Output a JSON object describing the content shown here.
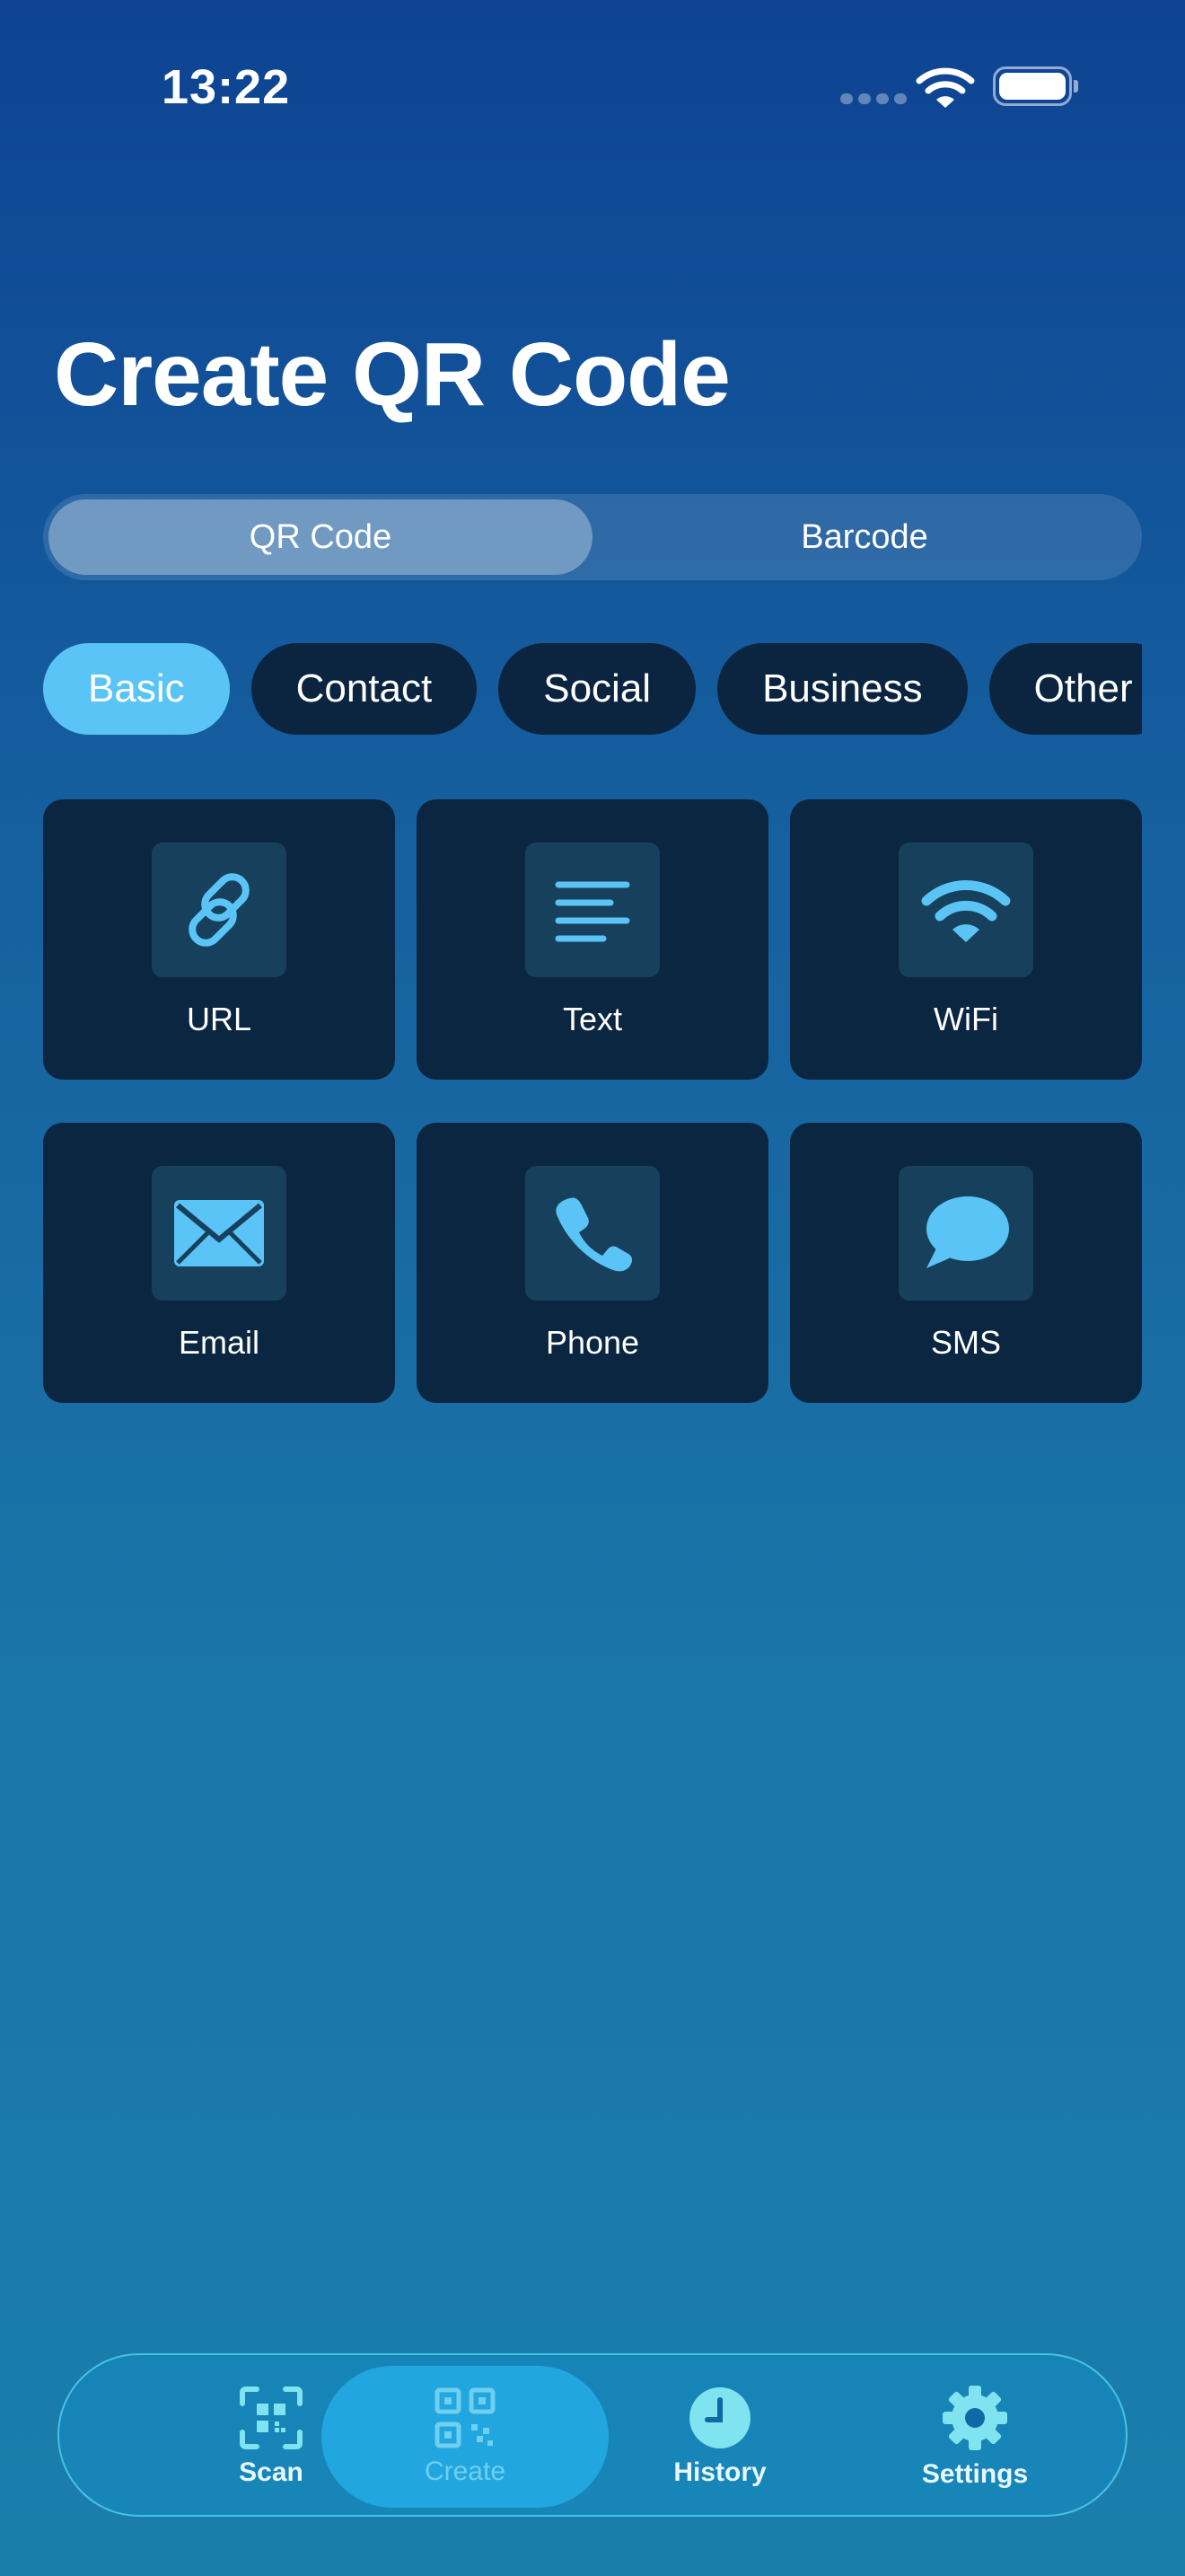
{
  "status_bar": {
    "time": "13:22"
  },
  "header": {
    "title": "Create QR Code"
  },
  "segmented_control": {
    "options": [
      {
        "label": "QR Code",
        "selected": true
      },
      {
        "label": "Barcode",
        "selected": false
      }
    ]
  },
  "categories": [
    {
      "label": "Basic",
      "selected": true
    },
    {
      "label": "Contact",
      "selected": false
    },
    {
      "label": "Social",
      "selected": false
    },
    {
      "label": "Business",
      "selected": false
    },
    {
      "label": "Other",
      "selected": false
    }
  ],
  "types": [
    {
      "label": "URL",
      "icon": "link-icon"
    },
    {
      "label": "Text",
      "icon": "text-lines-icon"
    },
    {
      "label": "WiFi",
      "icon": "wifi-icon"
    },
    {
      "label": "Email",
      "icon": "envelope-icon"
    },
    {
      "label": "Phone",
      "icon": "phone-icon"
    },
    {
      "label": "SMS",
      "icon": "message-bubble-icon"
    }
  ],
  "tabbar": {
    "items": [
      {
        "label": "Scan",
        "icon": "qr-scan-icon",
        "active": false
      },
      {
        "label": "Create",
        "icon": "qr-code-icon",
        "active": true
      },
      {
        "label": "History",
        "icon": "clock-icon",
        "active": false
      },
      {
        "label": "Settings",
        "icon": "gear-icon",
        "active": false
      }
    ]
  },
  "colors": {
    "accent": "#5ac4f7",
    "chip_background": "#0b2540",
    "card_background": "#0b2640",
    "icon_box_background": "#16405c",
    "tab_active": "#22a6e0"
  }
}
